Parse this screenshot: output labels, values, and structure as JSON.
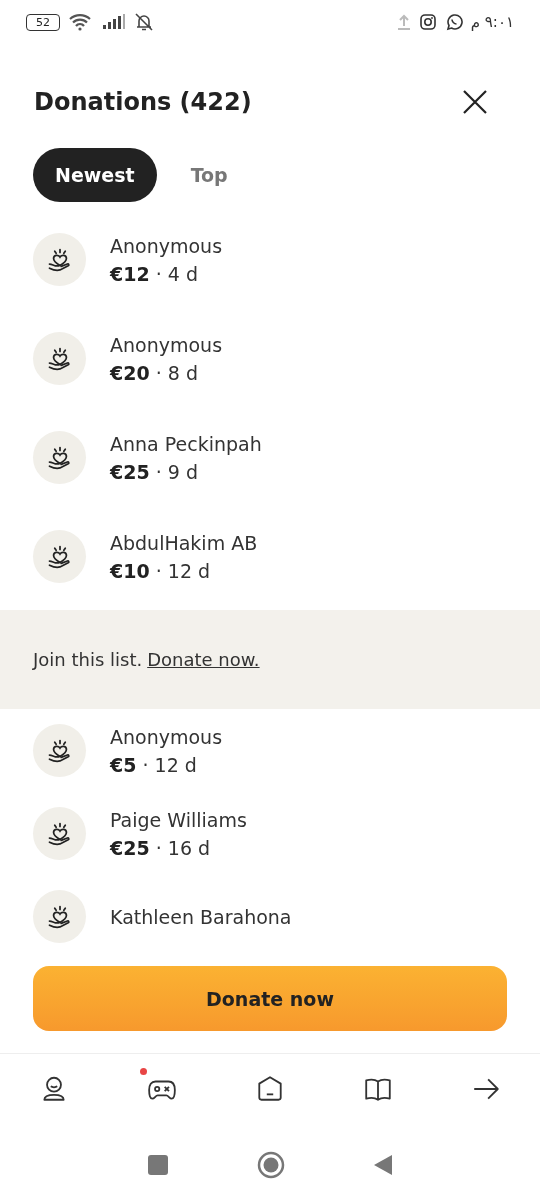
{
  "status_bar": {
    "battery": "52",
    "time": "٩:٠١ م"
  },
  "header": {
    "title": "Donations (422)"
  },
  "tabs": [
    {
      "label": "Newest",
      "selected": true
    },
    {
      "label": "Top",
      "selected": false
    }
  ],
  "donations": [
    {
      "name": "Anonymous",
      "detail": "**€12** · 4 d"
    },
    {
      "name": "Anonymous",
      "detail": "**€20** · 8 d"
    },
    {
      "name": "Anna Peckinpah",
      "detail": "**€25** · 9 d"
    },
    {
      "name": "AbdulHakim AB",
      "detail": "**€10** · 12 d"
    }
  ],
  "banner": {
    "text": "Join this list.",
    "link": "Donate now."
  },
  "donations_more": [
    {
      "name": "Anonymous",
      "detail": "**€5** · 12 d"
    },
    {
      "name": "Paige Williams",
      "detail": "**€25** · 16 d"
    },
    {
      "name": "Kathleen Barahona"
    }
  ],
  "donate_button": "Donate now",
  "nav": [
    {
      "kind": "profile",
      "badge": false
    },
    {
      "kind": "games",
      "badge": true
    },
    {
      "kind": "home",
      "badge": false
    },
    {
      "kind": "book",
      "badge": false
    },
    {
      "kind": "arrow",
      "badge": false
    }
  ]
}
